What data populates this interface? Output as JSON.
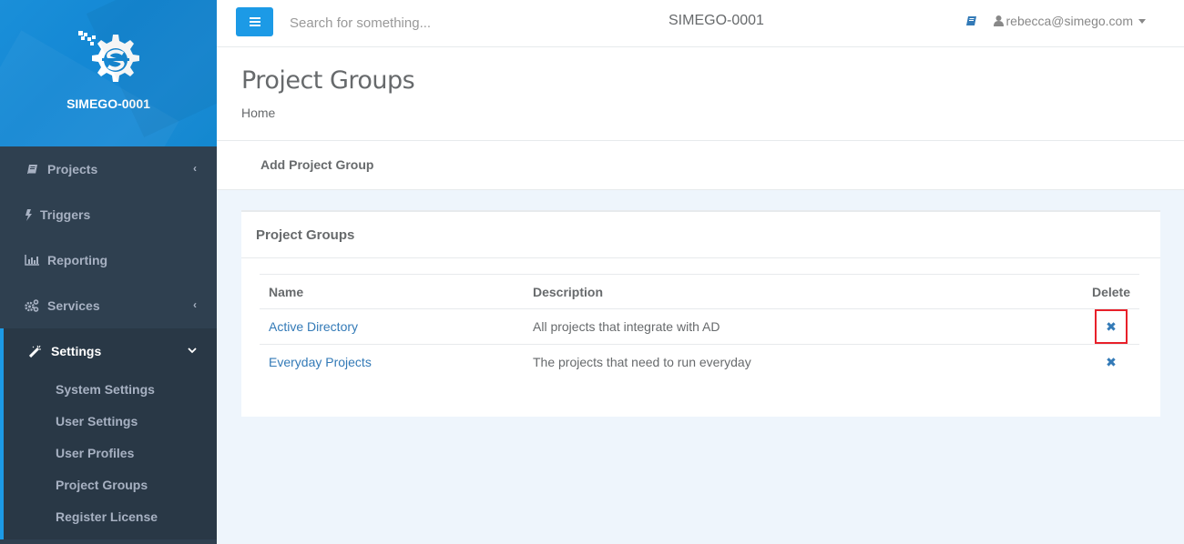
{
  "brand": {
    "name": "SIMEGO-0001",
    "logo_icon": "simego-gear-logo"
  },
  "sidebar": {
    "items": [
      {
        "label": "Projects",
        "icon": "book-icon",
        "has_arrow": true,
        "arrow": "‹"
      },
      {
        "label": "Triggers",
        "icon": "bolt-icon",
        "has_arrow": false
      },
      {
        "label": "Reporting",
        "icon": "bar-chart-icon",
        "has_arrow": false
      },
      {
        "label": "Services",
        "icon": "cogs-icon",
        "has_arrow": true,
        "arrow": "‹"
      },
      {
        "label": "Settings",
        "icon": "magic-wand-icon",
        "has_arrow": true,
        "arrow": "⌄",
        "active": true
      }
    ],
    "settings_subitems": [
      "System Settings",
      "User Settings",
      "User Profiles",
      "Project Groups",
      "Register License"
    ]
  },
  "topbar": {
    "menu_icon": "hamburger-icon",
    "search_placeholder": "Search for something...",
    "title": "SIMEGO-0001",
    "help_icon": "book-icon",
    "user_email": "rebecca@simego.com"
  },
  "page": {
    "title": "Project Groups",
    "breadcrumb": "Home",
    "add_button": "Add Project Group"
  },
  "panel": {
    "title": "Project Groups",
    "columns": [
      "Name",
      "Description",
      "Delete"
    ],
    "rows": [
      {
        "name": "Active Directory",
        "description": "All projects that integrate with AD",
        "delete_icon": "✖"
      },
      {
        "name": "Everyday Projects",
        "description": "The projects that need to run everyday",
        "delete_icon": "✖"
      }
    ]
  },
  "colors": {
    "accent": "#1c9ae6",
    "sidebar_bg": "#2f4050",
    "link": "#337ab7",
    "highlight": "#e8202a"
  }
}
